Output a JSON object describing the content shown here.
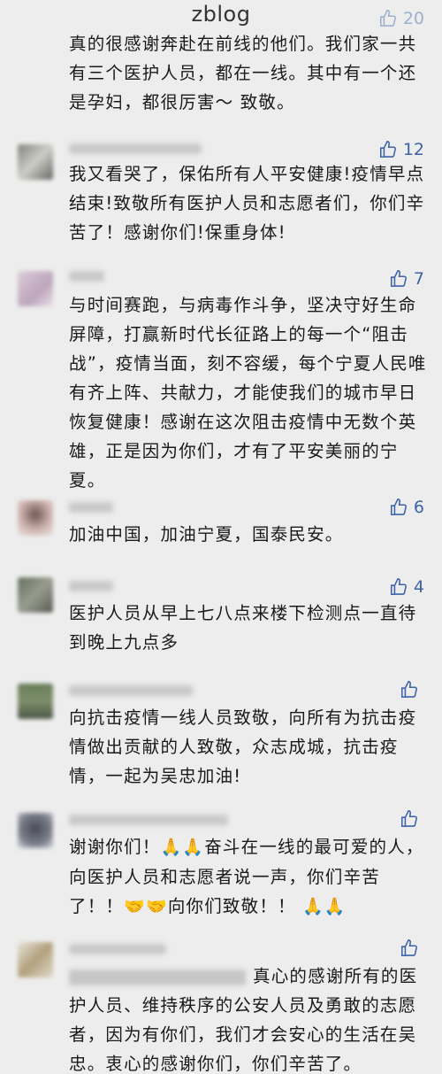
{
  "watermark": "zblog",
  "colors": {
    "background": "#ededed",
    "like_blue": "#3e63a8",
    "text": "#1a1a1a"
  },
  "comments": [
    {
      "likes": "20",
      "text": "真的很感谢奔赴在前线的他们。我们家一共有三个医护人员，都在一线。其中有一个还是孕妇，都很厉害～ 致敬。"
    },
    {
      "likes": "12",
      "text": "我又看哭了，保佑所有人平安健康!疫情早点结束!致敬所有医护人员和志愿者们，你们辛苦了！感谢你们!保重身体!"
    },
    {
      "likes": "7",
      "text": "与时间赛跑，与病毒作斗争，坚决守好生命屏障，打赢新时代长征路上的每一个“阻击战”，疫情当面，刻不容缓，每个宁夏人民唯有齐上阵、共献力，才能使我们的城市早日恢复健康！感谢在这次阻击疫情中无数个英雄，正是因为你们，才有了平安美丽的宁夏。"
    },
    {
      "likes": "6",
      "text": "加油中国，加油宁夏，国泰民安。"
    },
    {
      "likes": "4",
      "text": "医护人员从早上七八点来楼下检测点一直待到晚上九点多"
    },
    {
      "likes": "",
      "text": "向抗击疫情一线人员致敬，向所有为抗击疫情做出贡献的人致敬，众志成城，抗击疫情，一起为吴忠加油!"
    },
    {
      "likes": "",
      "text_a": "谢谢你们！",
      "text_b": "奋斗在一线的最可爱的人，向医护人员和志愿者说一声，你们辛苦了！！",
      "text_c": "向你们致敬！！"
    },
    {
      "likes": "",
      "text": "真心的感谢所有的医护人员、维持秩序的公安人员及勇敢的志愿者，因为有你们，我们才会安心的生活在吴忠。衷心的感谢你们，你们辛苦了。"
    }
  ]
}
